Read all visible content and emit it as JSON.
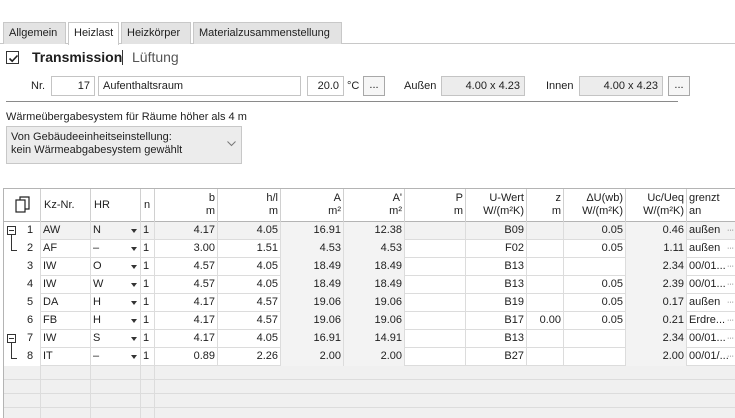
{
  "tabs": [
    {
      "label": "Allgemein",
      "active": false
    },
    {
      "label": "Heizlast",
      "active": true
    },
    {
      "label": "Heizkörper",
      "active": false
    },
    {
      "label": "Materialzusammenstellung",
      "active": false
    }
  ],
  "section": {
    "title": "Transmission",
    "subtitle": "Lüftung",
    "checked": true
  },
  "room": {
    "nr_label": "Nr.",
    "nr_value": "17",
    "name": "Aufenthaltsraum",
    "temp_value": "20.0",
    "temp_unit": "°C",
    "more_button": "...",
    "aussen_label": "Außen",
    "aussen_value": "4.00 x 4.23",
    "innen_label": "Innen",
    "innen_value": "4.00 x 4.23",
    "innen_button": "..."
  },
  "system": {
    "label": "Wärmeübergabesystem für Räume höher als 4 m",
    "value_line1": "Von Gebäudeeinheitseinstellung:",
    "value_line2": "kein Wärmeabgabesystem gewählt"
  },
  "table": {
    "headers": {
      "kz": "Kz-Nr.",
      "hr": "HR",
      "n": "n",
      "b": "b",
      "b_unit": "m",
      "hl": "h/l",
      "hl_unit": "m",
      "a": "A",
      "a_unit": "m²",
      "a2": "A'",
      "a2_unit": "m²",
      "p": "P",
      "p_unit": "m",
      "u": "U-Wert",
      "u_unit": "W/(m²K)",
      "z": "z",
      "z_unit": "m",
      "du": "ΔU(wb)",
      "du_unit": "W/(m²K)",
      "uc": "Uc/Ueq",
      "uc_unit": "W/(m²K)",
      "grenzt": "grenzt",
      "grenzt2": "an"
    },
    "rows": [
      {
        "idx": "1",
        "kz": "AW",
        "hr": "N",
        "n": "1",
        "b": "4.17",
        "hl": "4.05",
        "a": "16.91",
        "a2": "12.38",
        "p": "",
        "u": "B09",
        "z": "",
        "du": "0.05",
        "uc": "0.46",
        "grenzt": "außen",
        "tree": "open"
      },
      {
        "idx": "2",
        "kz": "AF",
        "hr": "–",
        "n": "1",
        "b": "3.00",
        "hl": "1.51",
        "a": "4.53",
        "a2": "4.53",
        "p": "",
        "u": "F02",
        "z": "",
        "du": "0.05",
        "uc": "1.11",
        "grenzt": "außen",
        "tree": "end"
      },
      {
        "idx": "3",
        "kz": "IW",
        "hr": "O",
        "n": "1",
        "b": "4.57",
        "hl": "4.05",
        "a": "18.49",
        "a2": "18.49",
        "p": "",
        "u": "B13",
        "z": "",
        "du": "",
        "uc": "2.34",
        "grenzt": "00/01...",
        "tree": ""
      },
      {
        "idx": "4",
        "kz": "IW",
        "hr": "W",
        "n": "1",
        "b": "4.57",
        "hl": "4.05",
        "a": "18.49",
        "a2": "18.49",
        "p": "",
        "u": "B13",
        "z": "",
        "du": "0.05",
        "uc": "2.39",
        "grenzt": "00/01...",
        "tree": ""
      },
      {
        "idx": "5",
        "kz": "DA",
        "hr": "H",
        "n": "1",
        "b": "4.17",
        "hl": "4.57",
        "a": "19.06",
        "a2": "19.06",
        "p": "",
        "u": "B19",
        "z": "",
        "du": "0.05",
        "uc": "0.17",
        "grenzt": "außen",
        "tree": ""
      },
      {
        "idx": "6",
        "kz": "FB",
        "hr": "H",
        "n": "1",
        "b": "4.17",
        "hl": "4.57",
        "a": "19.06",
        "a2": "19.06",
        "p": "",
        "u": "B17",
        "z": "0.00",
        "du": "0.05",
        "uc": "0.21",
        "grenzt": "Erdre...",
        "tree": ""
      },
      {
        "idx": "7",
        "kz": "IW",
        "hr": "S",
        "n": "1",
        "b": "4.17",
        "hl": "4.05",
        "a": "16.91",
        "a2": "14.91",
        "p": "",
        "u": "B13",
        "z": "",
        "du": "",
        "uc": "2.34",
        "grenzt": "00/01...",
        "tree": "open"
      },
      {
        "idx": "8",
        "kz": "IT",
        "hr": "–",
        "n": "1",
        "b": "0.89",
        "hl": "2.26",
        "a": "2.00",
        "a2": "2.00",
        "p": "",
        "u": "B27",
        "z": "",
        "du": "",
        "uc": "2.00",
        "grenzt": "00/01/...",
        "tree": "end"
      }
    ]
  }
}
